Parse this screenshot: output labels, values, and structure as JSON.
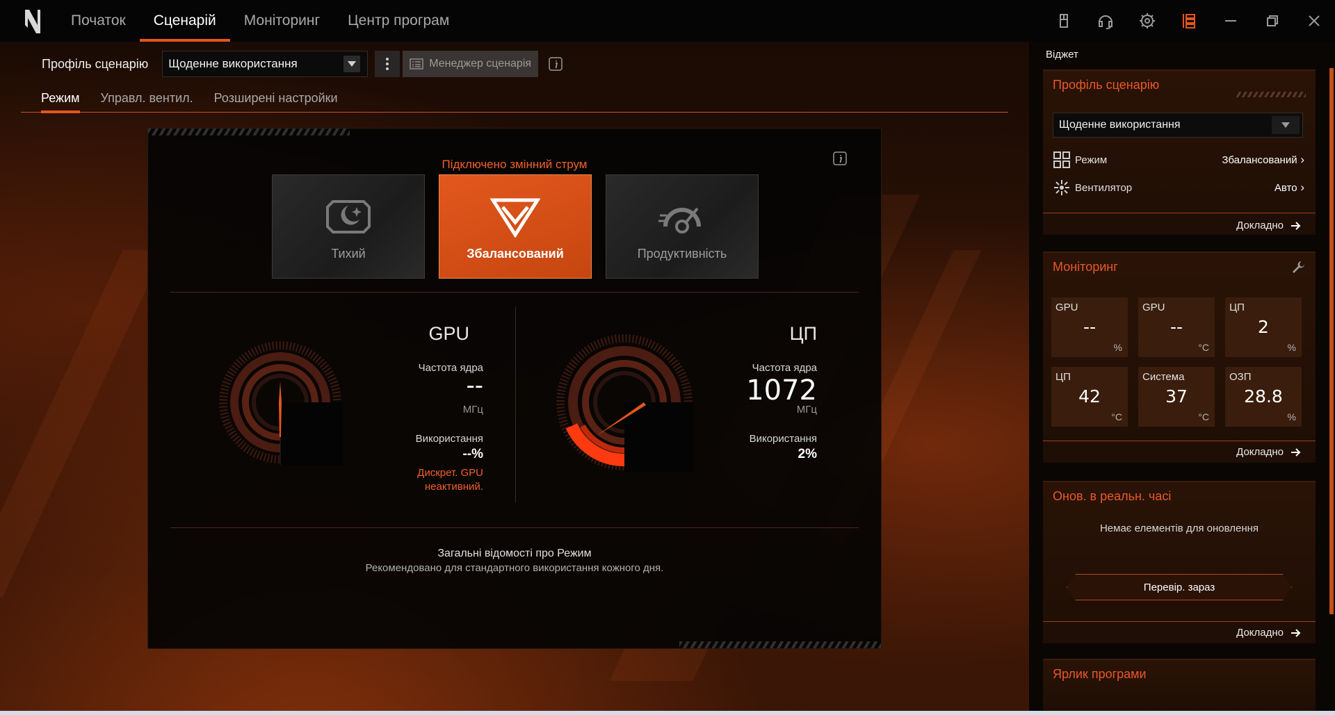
{
  "nav": {
    "tabs": [
      {
        "label": "Початок",
        "active": false
      },
      {
        "label": "Сценарій",
        "active": true
      },
      {
        "label": "Моніторинг",
        "active": false
      },
      {
        "label": "Центр програм",
        "active": false
      }
    ]
  },
  "top_icons": [
    "mouse-icon",
    "headset-icon",
    "settings-icon",
    "widget-panel-icon",
    "minimize-icon",
    "restore-icon",
    "close-icon"
  ],
  "profile": {
    "label": "Профіль сценарію",
    "selected": "Щоденне використання",
    "manager_label": "Менеджер сценарія"
  },
  "subtabs": [
    {
      "label": "Режим",
      "active": true
    },
    {
      "label": "Управл. вентил.",
      "active": false
    },
    {
      "label": "Розширені настройки",
      "active": false
    }
  ],
  "mode_panel": {
    "power_status": "Підключено змінний струм",
    "modes": [
      {
        "label": "Тихий",
        "icon": "quiet-moon-icon",
        "active": false
      },
      {
        "label": "Збалансований",
        "icon": "balanced-icon",
        "active": true
      },
      {
        "label": "Продуктивність",
        "icon": "performance-gauge-icon",
        "active": false
      }
    ],
    "gpu": {
      "title": "GPU",
      "freq_label": "Частота ядра",
      "freq_value": "--",
      "freq_unit": "МГц",
      "usage_label": "Використання",
      "usage_value": "--%",
      "warning_line1": "Дискрет. GPU",
      "warning_line2": "неактивний."
    },
    "cpu": {
      "title": "ЦП",
      "freq_label": "Частота ядра",
      "freq_value": "1072",
      "freq_unit": "МГц",
      "usage_label": "Використання",
      "usage_value": "2%",
      "usage_fraction": 0.02
    },
    "summary_title": "Загальні відомості про Режим",
    "summary_desc": "Рекомендовано для стандартного використання кожного дня."
  },
  "widget": {
    "header": "Віджет",
    "profile_card": {
      "title": "Профіль сценарію",
      "selected": "Щоденне використання",
      "rows": [
        {
          "label": "Режим",
          "value": "Збалансований",
          "icon": "mode-grid-icon"
        },
        {
          "label": "Вентилятор",
          "value": "Авто",
          "icon": "fan-icon"
        }
      ],
      "more": "Докладно"
    },
    "monitor_card": {
      "title": "Моніторинг",
      "tiles": [
        {
          "label": "GPU",
          "value": "--",
          "unit": "%"
        },
        {
          "label": "GPU",
          "value": "--",
          "unit": "°C"
        },
        {
          "label": "ЦП",
          "value": "2",
          "unit": "%"
        },
        {
          "label": "ЦП",
          "value": "42",
          "unit": "°C"
        },
        {
          "label": "Система",
          "value": "37",
          "unit": "°C"
        },
        {
          "label": "ОЗП",
          "value": "28.8",
          "unit": "%"
        }
      ],
      "more": "Докладно"
    },
    "update_card": {
      "title": "Онов. в реальн. часі",
      "empty_text": "Немає елементів для оновлення",
      "check_button": "Перевір. зараз",
      "more": "Докладно"
    },
    "shortcut_card": {
      "title": "Ярлик програми"
    }
  },
  "colors": {
    "accent": "#e4561c",
    "accent_text": "#e9582a",
    "top_bar": "#050505"
  }
}
